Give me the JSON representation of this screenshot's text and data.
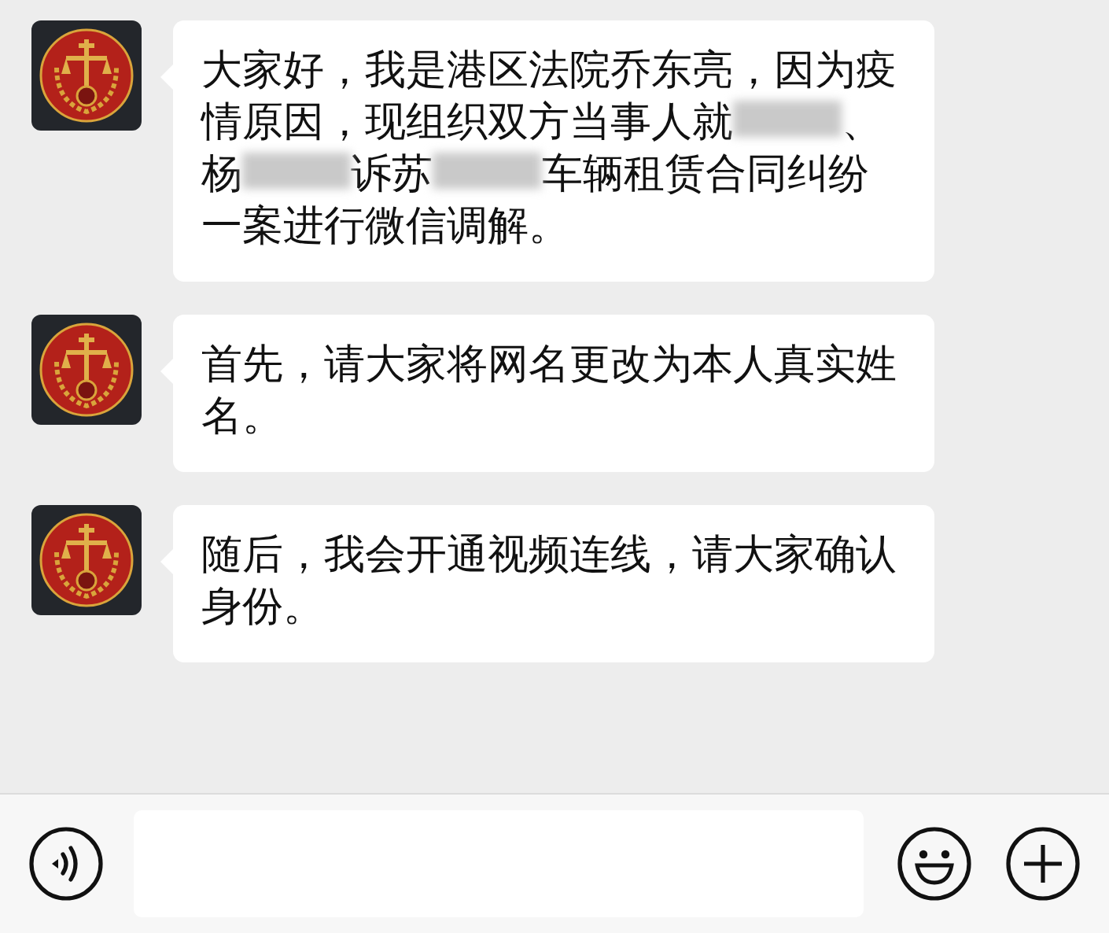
{
  "messages": [
    {
      "segments": [
        {
          "kind": "text",
          "text": "大家好，我是港区法院乔东亮，因为疫情原因，现组织双方当事人就"
        },
        {
          "kind": "redacted"
        },
        {
          "kind": "text",
          "text": "、杨"
        },
        {
          "kind": "redacted"
        },
        {
          "kind": "text",
          "text": "诉苏"
        },
        {
          "kind": "redacted"
        },
        {
          "kind": "text",
          "text": "车辆租赁合同纠纷一案进行微信调解。"
        }
      ]
    },
    {
      "segments": [
        {
          "kind": "text",
          "text": "首先，请大家将网名更改为本人真实姓名。"
        }
      ]
    },
    {
      "segments": [
        {
          "kind": "text",
          "text": "随后，我会开通视频连线，请大家确认身份。"
        }
      ]
    }
  ]
}
